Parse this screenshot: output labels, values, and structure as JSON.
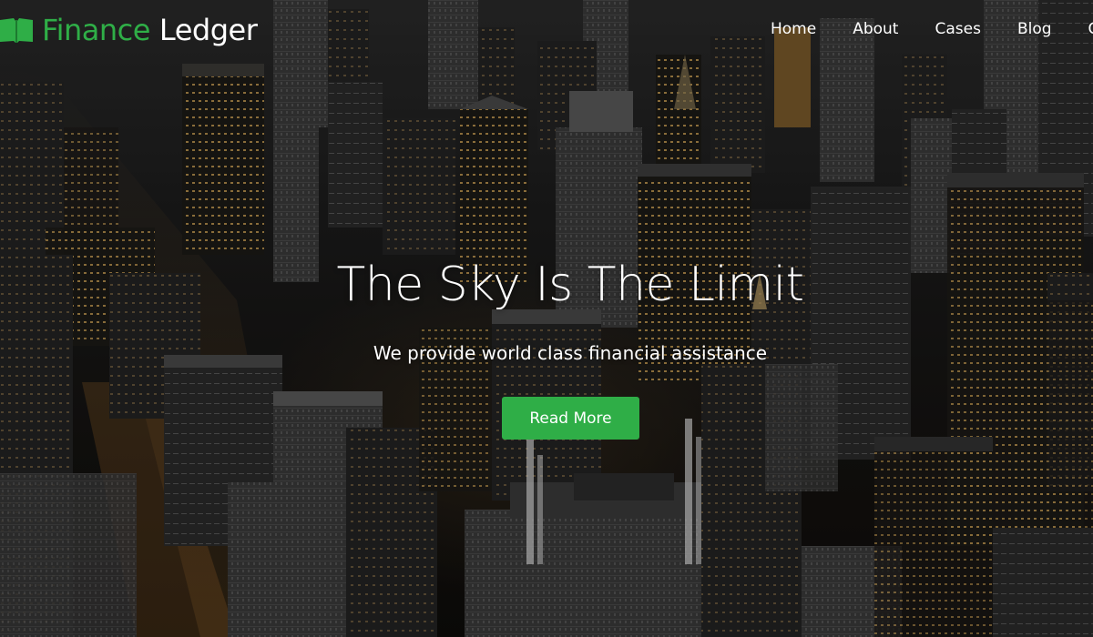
{
  "brand": {
    "name_part_1": "Finance",
    "name_part_2": "Ledger",
    "icon": "open-book-icon",
    "accent_color": "#2fae47"
  },
  "nav": {
    "items": [
      {
        "label": "Home"
      },
      {
        "label": "About"
      },
      {
        "label": "Cases"
      },
      {
        "label": "Blog"
      },
      {
        "label": "C"
      }
    ]
  },
  "hero": {
    "title": "The Sky Is The Limit",
    "subtitle": "We provide world class financial assistance",
    "button_label": "Read More",
    "background": "night-city-skyline-photo"
  }
}
